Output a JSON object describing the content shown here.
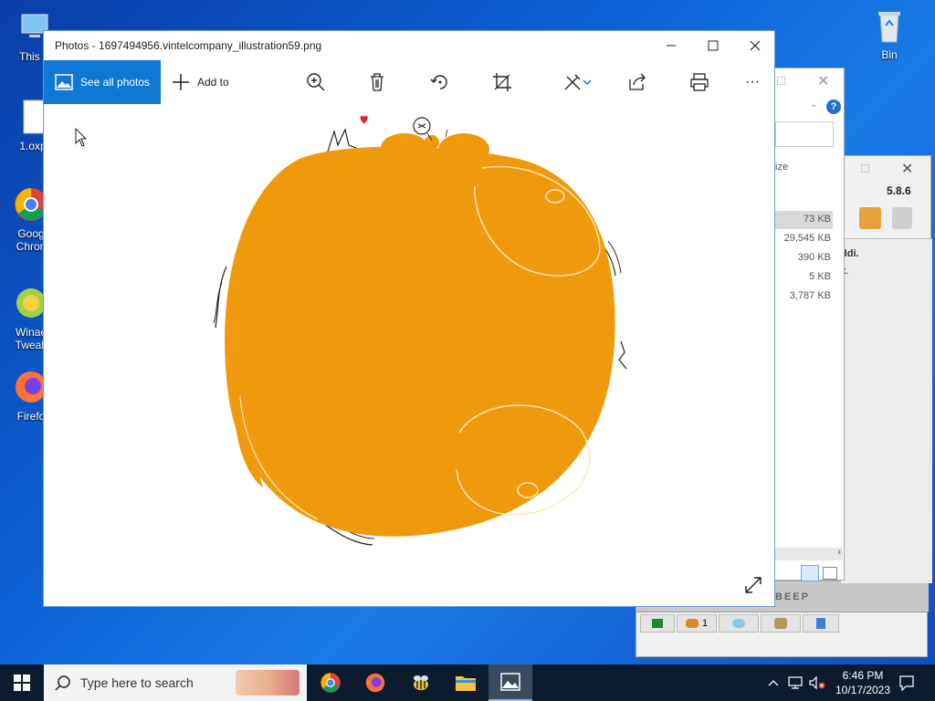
{
  "desktop": {
    "icons": [
      {
        "label": "This P"
      },
      {
        "label": "1.oxp"
      },
      {
        "label": "Goog Chron"
      },
      {
        "label": "Winae Tweak"
      },
      {
        "label": "Firefo"
      },
      {
        "label": "Bin"
      }
    ]
  },
  "bg_window_1": {
    "size_header": "ize",
    "sizes": [
      "73 KB",
      "29,545 KB",
      "390 KB",
      "5 KB",
      "3,787 KB"
    ]
  },
  "bg_window_2": {
    "version": "5.8.6",
    "text1": "ddi.",
    "text2": "k."
  },
  "bg_window_3": {
    "label": "BEEP",
    "count": "1"
  },
  "photos": {
    "title": "Photos - 1697494956.vintelcompany_illustration59.png",
    "see_all": "See all photos",
    "add_to": "Add to",
    "more": "···"
  },
  "taskbar": {
    "search_placeholder": "Type here to search",
    "time": "6:46 PM",
    "date": "10/17/2023"
  },
  "colors": {
    "accent": "#0e78d4",
    "orange": "#ef9a0c",
    "taskbar": "#0d1b2e"
  }
}
